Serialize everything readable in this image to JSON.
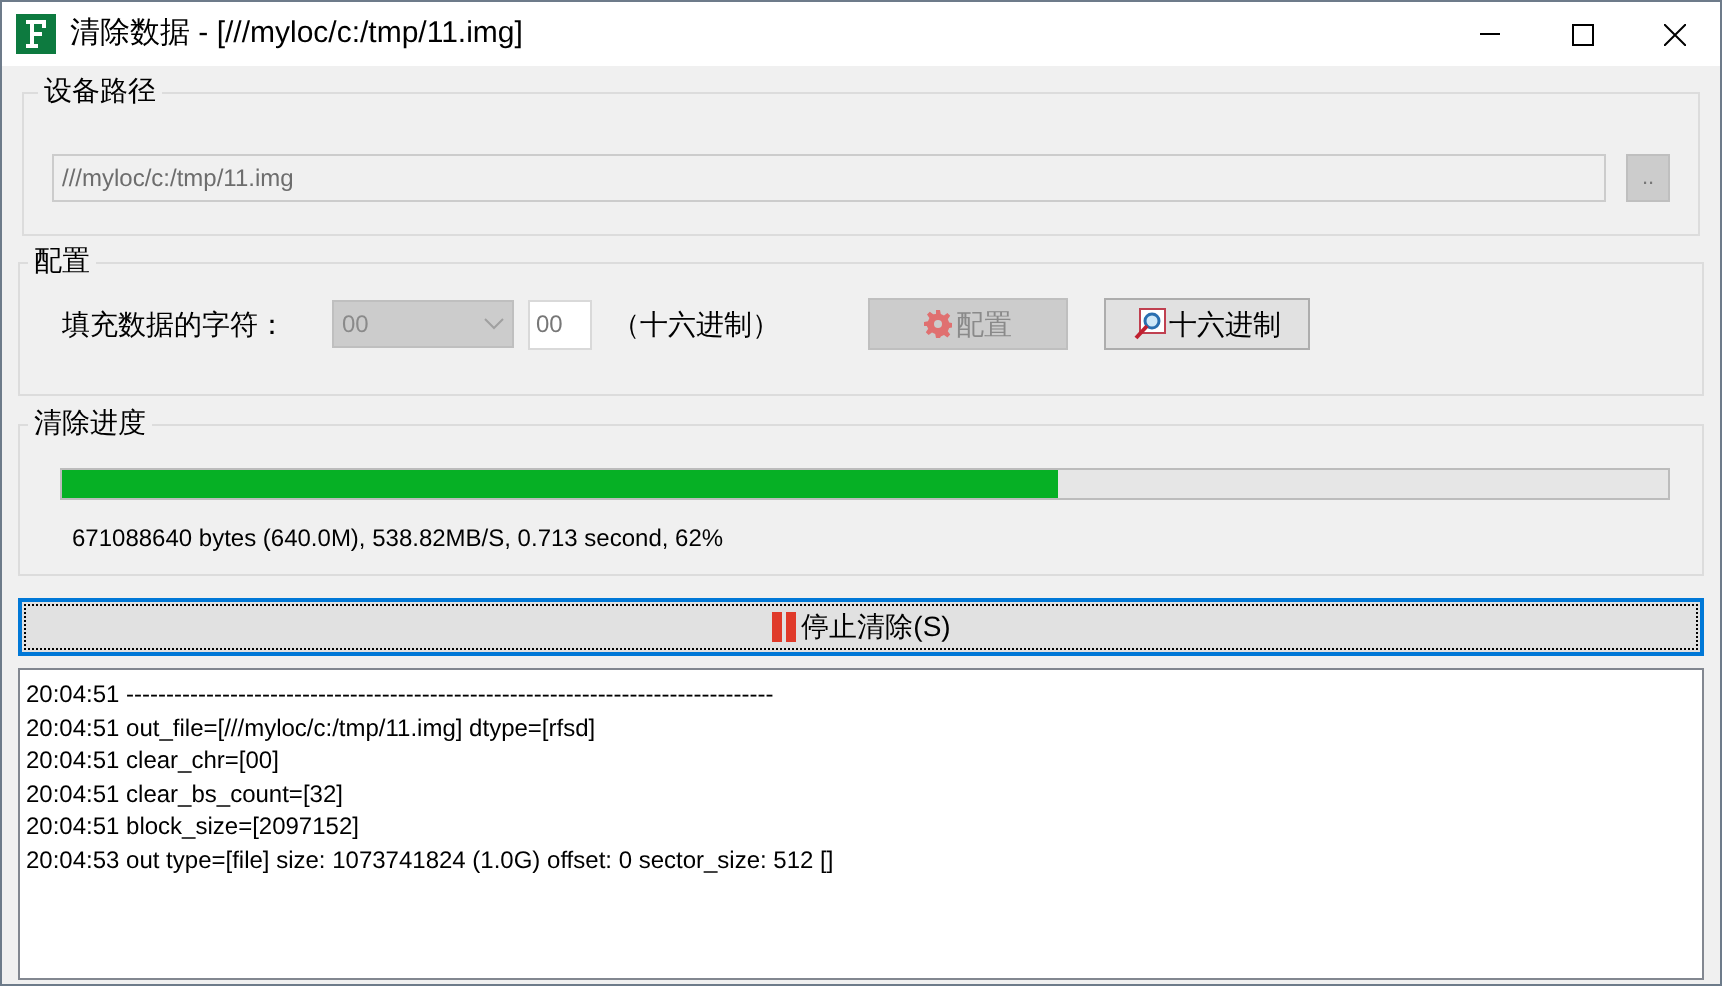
{
  "window": {
    "title": "清除数据 - [///myloc/c:/tmp/11.img]"
  },
  "device_path": {
    "title": "设备路径",
    "value": "///myloc/c:/tmp/11.img",
    "disabled": true,
    "browse_label": ".."
  },
  "config": {
    "title": "配置",
    "fill_label": "填充数据的字符：",
    "combo_value": "00",
    "combo_disabled": true,
    "hex_value": "00",
    "hex_note": "（十六进制）",
    "buttons": [
      {
        "kind": "settings",
        "label": "配置",
        "disabled": true
      },
      {
        "kind": "hex",
        "label": "十六进制",
        "disabled": false
      }
    ]
  },
  "progress": {
    "title": "清除进度",
    "level": 0.62,
    "status": "671088640 bytes (640.0M), 538.82MB/S, 0.713 second, 62%"
  },
  "stop_button": {
    "label": "停止清除(S)",
    "focused": true
  },
  "log": [
    "20:04:51 ---------------------------------------------------------------------------------",
    "20:04:51 out_file=[///myloc/c:/tmp/11.img] dtype=[rfsd]",
    "20:04:51 clear_chr=[00]",
    "20:04:51 clear_bs_count=[32]",
    "20:04:51 block_size=[2097152]",
    "20:04:53 out type=[file] size: 1073741824 (1.0G) offset: 0 sector_size: 512 []"
  ]
}
